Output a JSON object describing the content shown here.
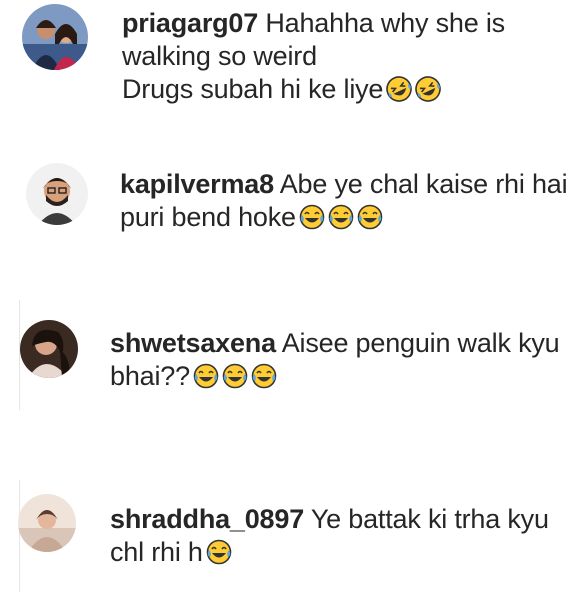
{
  "comments": [
    {
      "username": "priagarg07",
      "text": "Hahahha why she is walking so weird\nDrugs subah hi ke liye",
      "emoji": [
        "rofl-emoji",
        "rofl-emoji"
      ]
    },
    {
      "username": "kapilverma8",
      "text": "Abe ye chal kaise rhi hai puri bend hoke",
      "emoji": [
        "tears-of-joy-emoji",
        "tears-of-joy-emoji",
        "tears-of-joy-emoji"
      ]
    },
    {
      "username": "shwetsaxena",
      "text": "Aisee penguin walk kyu bhai??",
      "emoji": [
        "tears-of-joy-emoji",
        "tears-of-joy-emoji",
        "tears-of-joy-emoji"
      ]
    },
    {
      "username": "shraddha_0897",
      "text": "Ye battak ki trha kyu chl rhi h",
      "emoji": [
        "tears-of-joy-emoji"
      ]
    }
  ],
  "colors": {
    "text": "#262626",
    "emoji_face": "#ffcc33",
    "emoji_outline": "#333333",
    "tear": "#5aa7e0"
  }
}
